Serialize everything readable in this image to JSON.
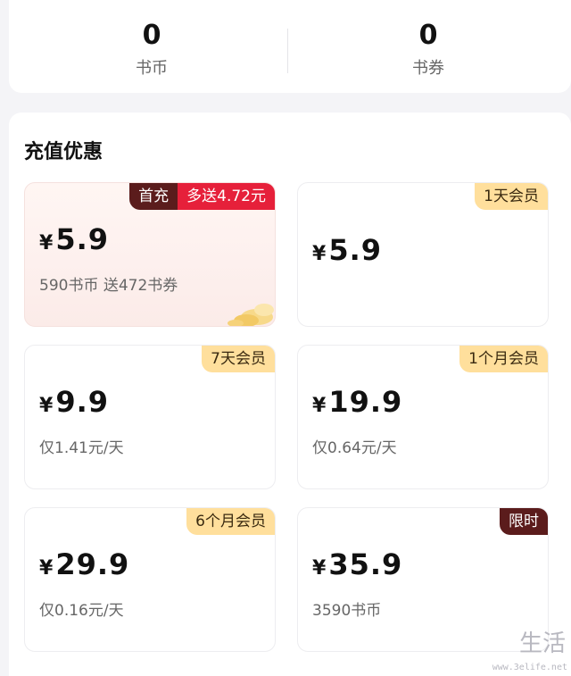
{
  "balances": [
    {
      "value": "0",
      "label": "书币"
    },
    {
      "value": "0",
      "label": "书券"
    }
  ],
  "section_title": "充值优惠",
  "offers": [
    {
      "price_symbol": "¥",
      "price": "5.9",
      "sub": "590书币 送472书券",
      "tags": [
        "首充",
        "多送4.72元"
      ]
    },
    {
      "price_symbol": "¥",
      "price": "5.9",
      "sub": "",
      "tags": [
        "1天会员"
      ]
    },
    {
      "price_symbol": "¥",
      "price": "9.9",
      "sub": "仅1.41元/天",
      "tags": [
        "7天会员"
      ]
    },
    {
      "price_symbol": "¥",
      "price": "19.9",
      "sub": "仅0.64元/天",
      "tags": [
        "1个月会员"
      ]
    },
    {
      "price_symbol": "¥",
      "price": "29.9",
      "sub": "仅0.16元/天",
      "tags": [
        "6个月会员"
      ]
    },
    {
      "price_symbol": "¥",
      "price": "35.9",
      "sub": "3590书币",
      "tags": [
        "限时"
      ]
    }
  ],
  "watermark": {
    "text": "生活",
    "url": "www.3elife.net"
  },
  "colors": {
    "tag_gold": "#ffdf9c",
    "tag_dark": "#5b1c1c",
    "tag_red": "#e6203a"
  }
}
